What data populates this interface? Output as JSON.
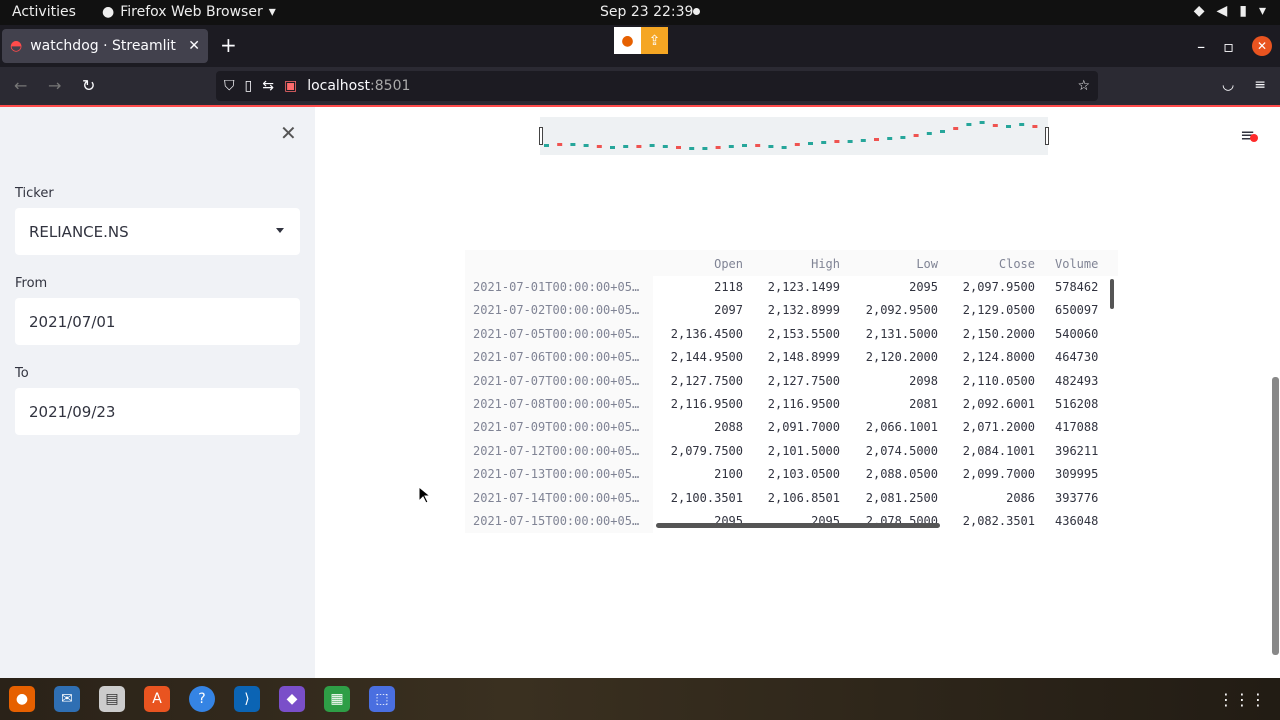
{
  "system": {
    "activities": "Activities",
    "app_menu": "Firefox Web Browser",
    "clock": "Sep 23  22:39"
  },
  "browser": {
    "tab_title": "watchdog · Streamlit",
    "url_host": "localhost",
    "url_port": ":8501"
  },
  "sidebar": {
    "ticker_label": "Ticker",
    "ticker_value": "RELIANCE.NS",
    "from_label": "From",
    "from_value": "2021/07/01",
    "to_label": "To",
    "to_value": "2021/09/23"
  },
  "table": {
    "columns": [
      "Open",
      "High",
      "Low",
      "Close",
      "Volume"
    ],
    "rows": [
      {
        "index": "2021-07-01T00:00:00+05…",
        "open": "2118",
        "high": "2,123.1499",
        "low": "2095",
        "close": "2,097.9500",
        "volume": "578462"
      },
      {
        "index": "2021-07-02T00:00:00+05…",
        "open": "2097",
        "high": "2,132.8999",
        "low": "2,092.9500",
        "close": "2,129.0500",
        "volume": "650097"
      },
      {
        "index": "2021-07-05T00:00:00+05…",
        "open": "2,136.4500",
        "high": "2,153.5500",
        "low": "2,131.5000",
        "close": "2,150.2000",
        "volume": "540060"
      },
      {
        "index": "2021-07-06T00:00:00+05…",
        "open": "2,144.9500",
        "high": "2,148.8999",
        "low": "2,120.2000",
        "close": "2,124.8000",
        "volume": "464730"
      },
      {
        "index": "2021-07-07T00:00:00+05…",
        "open": "2,127.7500",
        "high": "2,127.7500",
        "low": "2098",
        "close": "2,110.0500",
        "volume": "482493"
      },
      {
        "index": "2021-07-08T00:00:00+05…",
        "open": "2,116.9500",
        "high": "2,116.9500",
        "low": "2081",
        "close": "2,092.6001",
        "volume": "516208"
      },
      {
        "index": "2021-07-09T00:00:00+05…",
        "open": "2088",
        "high": "2,091.7000",
        "low": "2,066.1001",
        "close": "2,071.2000",
        "volume": "417088"
      },
      {
        "index": "2021-07-12T00:00:00+05…",
        "open": "2,079.7500",
        "high": "2,101.5000",
        "low": "2,074.5000",
        "close": "2,084.1001",
        "volume": "396211"
      },
      {
        "index": "2021-07-13T00:00:00+05…",
        "open": "2100",
        "high": "2,103.0500",
        "low": "2,088.0500",
        "close": "2,099.7000",
        "volume": "309995"
      },
      {
        "index": "2021-07-14T00:00:00+05…",
        "open": "2,100.3501",
        "high": "2,106.8501",
        "low": "2,081.2500",
        "close": "2086",
        "volume": "393776"
      },
      {
        "index": "2021-07-15T00:00:00+05…",
        "open": "2095",
        "high": "2095",
        "low": "2,078.5000",
        "close": "2,082.3501",
        "volume": "436048"
      }
    ]
  },
  "colors": {
    "accent": "#ff4b4b",
    "up": "#26a69a",
    "down": "#ef5350",
    "sidebar_bg": "#f0f2f6"
  },
  "icons": [
    "firefox-icon",
    "shield-icon",
    "page-icon",
    "bookmark-star-icon",
    "pocket-icon",
    "menu-icon",
    "close-icon",
    "caret-down-icon"
  ]
}
